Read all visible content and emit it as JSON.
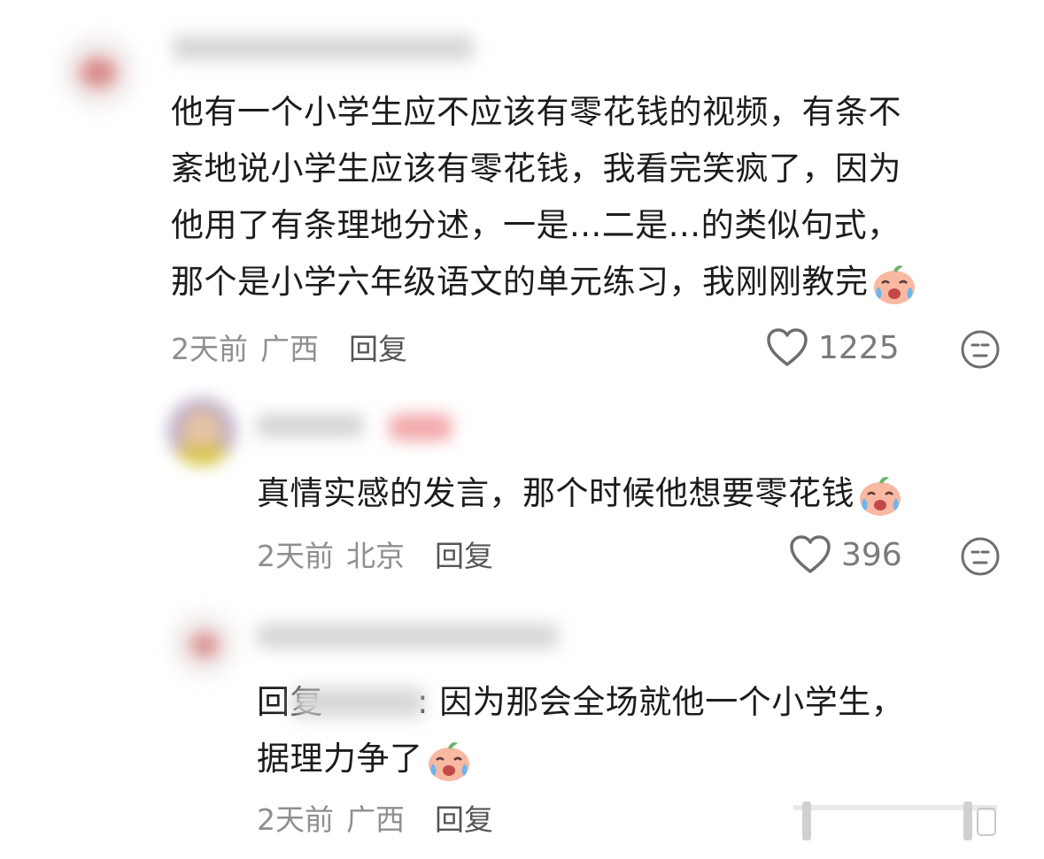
{
  "comments": [
    {
      "username": "",
      "text_lines": [
        "他有一个小学生应不应该有零花钱的视频，有条不",
        "紊地说小学生应该有零花钱，我看完笑疯了，因为",
        "他用了有条理地分述，一是...二是...的类似句式，",
        "那个是小学六年级语文的单元练习，我刚刚教完"
      ],
      "time": "2天前",
      "location": "广西",
      "reply_label": "回复",
      "likes": "1225"
    },
    {
      "username": "",
      "text": "真情实感的发言，那个时候他想要零花钱",
      "time": "2天前",
      "location": "北京",
      "reply_label": "回复",
      "likes": "396"
    },
    {
      "username": "",
      "reply_prefix": "回复",
      "reply_target": "",
      "text_lines": [
        ": 因为那会全场就他一个小学生，",
        "据理力争了"
      ],
      "time": "2天前",
      "location": "广西",
      "reply_label": "回复"
    }
  ],
  "icons": {
    "like": "heart-outline-icon",
    "dislike": "neutral-face-icon",
    "emoji": "crying-laughing-peach-emoji"
  },
  "colors": {
    "text": "#1c1c1c",
    "meta": "#8f8f8f",
    "icon": "#6e6e6e",
    "emoji_peach": "#f7b7a3"
  }
}
